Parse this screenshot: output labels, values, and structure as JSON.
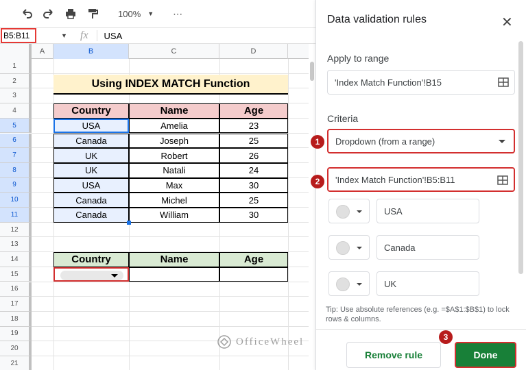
{
  "toolbar": {
    "zoom": "100%",
    "more": "⋯"
  },
  "formula_bar": {
    "name_box": "B5:B11",
    "fx": "fx",
    "value": "USA"
  },
  "columns": [
    "A",
    "B",
    "C",
    "D"
  ],
  "rows": [
    "1",
    "2",
    "3",
    "4",
    "5",
    "6",
    "7",
    "8",
    "9",
    "10",
    "11",
    "12",
    "13",
    "14",
    "15",
    "16",
    "17",
    "18",
    "19",
    "20",
    "21"
  ],
  "sheet": {
    "title": "Using INDEX MATCH Function",
    "table1": {
      "headers": [
        "Country",
        "Name",
        "Age"
      ],
      "rows": [
        [
          "USA",
          "Amelia",
          "23"
        ],
        [
          "Canada",
          "Joseph",
          "25"
        ],
        [
          "UK",
          "Robert",
          "26"
        ],
        [
          "UK",
          "Natali",
          "24"
        ],
        [
          "USA",
          "Max",
          "30"
        ],
        [
          "Canada",
          "Michel",
          "25"
        ],
        [
          "Canada",
          "William",
          "30"
        ]
      ]
    },
    "table2": {
      "headers": [
        "Country",
        "Name",
        "Age"
      ]
    }
  },
  "panel": {
    "title": "Data validation rules",
    "apply_label": "Apply to range",
    "apply_value": "'Index Match Function'!B15",
    "criteria_label": "Criteria",
    "criteria_value": "Dropdown (from a range)",
    "range_value": "'Index Match Function'!B5:B11",
    "items": [
      "USA",
      "Canada",
      "UK"
    ],
    "tip": "Tip: Use absolute references (e.g. =$A$1:$B$1) to lock rows & columns.",
    "remove_label": "Remove rule",
    "done_label": "Done"
  },
  "badges": [
    "1",
    "2",
    "3"
  ],
  "watermark": "OfficeWheel",
  "colors": {
    "header_red": "#f4cccc",
    "header_green": "#d9ead3",
    "selected_blue": "#e8f0fe",
    "title_yellow": "#fff2cc",
    "done_green": "#188038",
    "highlight_red": "#d32f2f"
  }
}
